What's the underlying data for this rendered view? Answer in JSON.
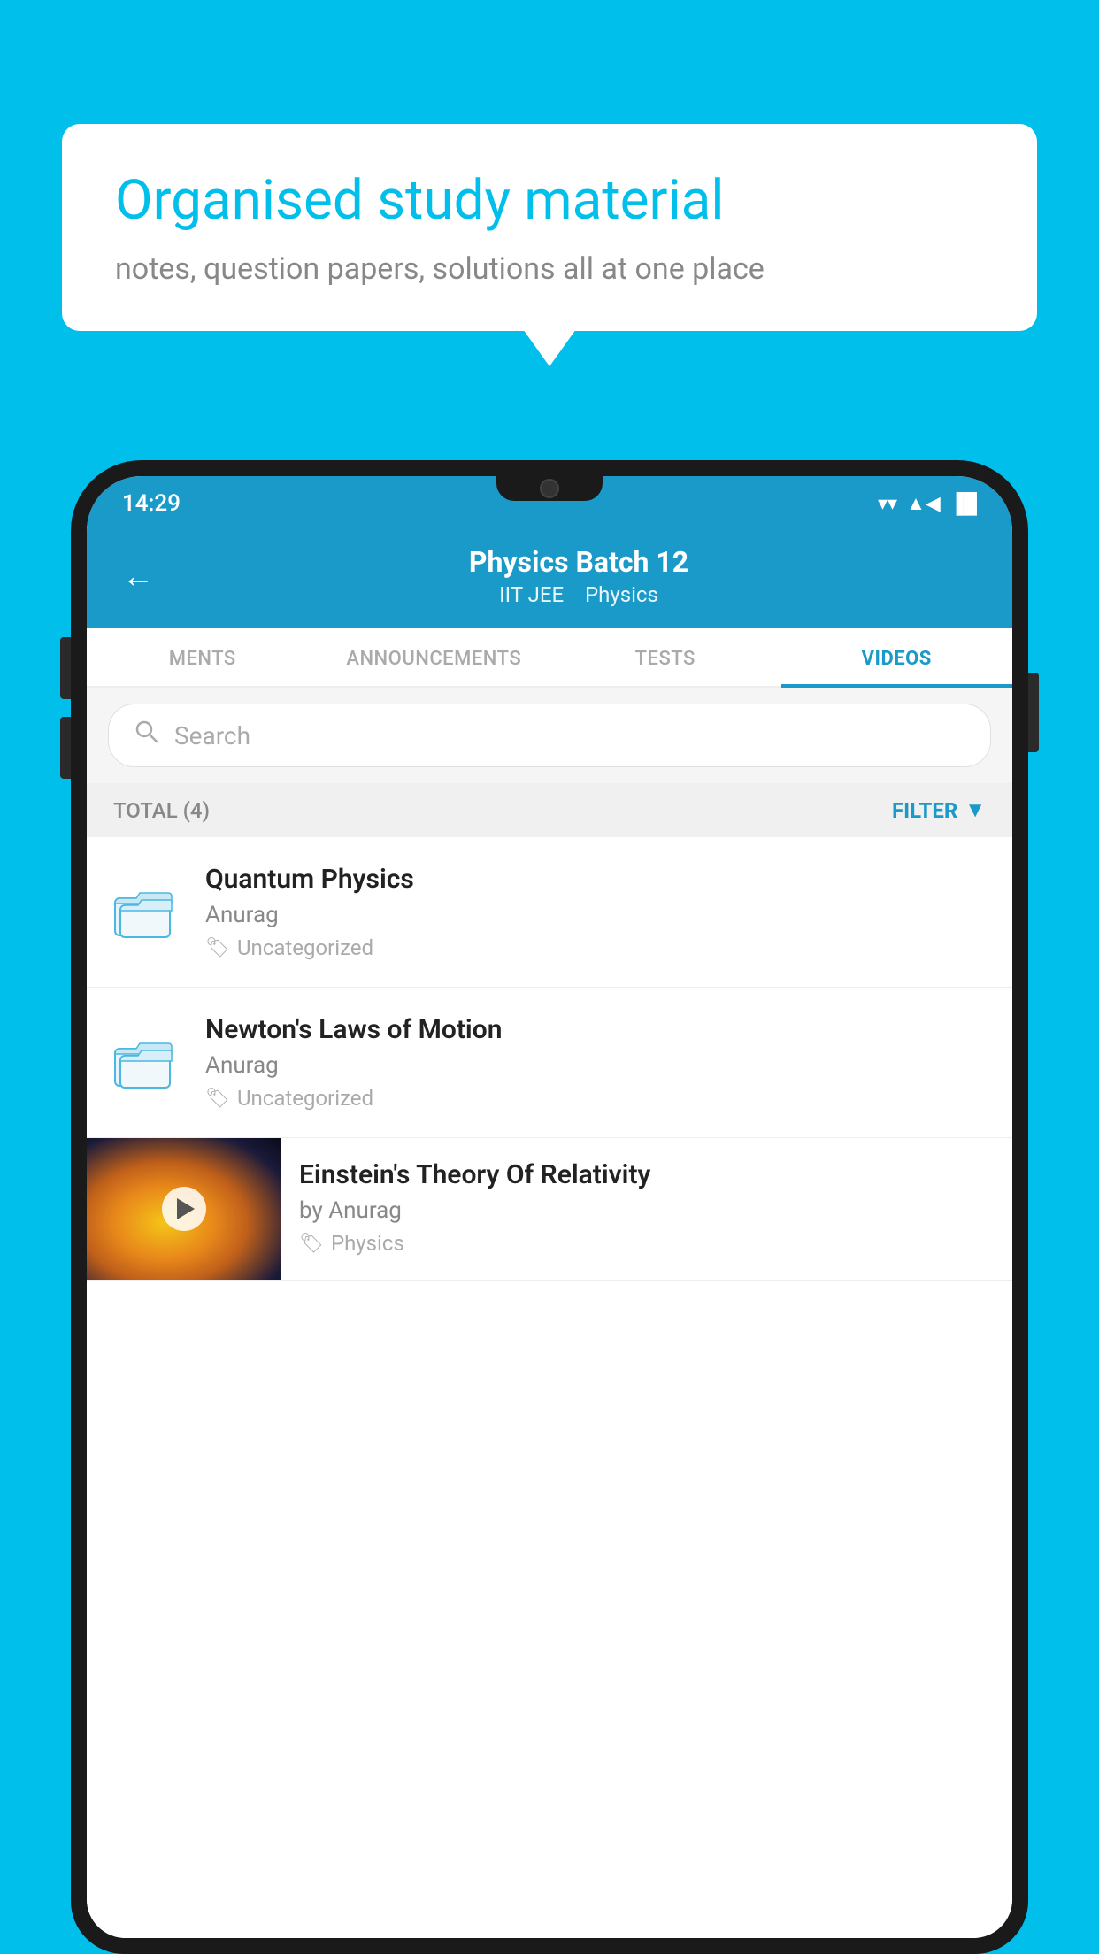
{
  "background_color": "#00BFEA",
  "speech_bubble": {
    "title": "Organised study material",
    "subtitle": "notes, question papers, solutions all at one place"
  },
  "phone": {
    "status_bar": {
      "time": "14:29"
    },
    "header": {
      "back_label": "←",
      "title": "Physics Batch 12",
      "subtitle_tag1": "IIT JEE",
      "subtitle_tag2": "Physics"
    },
    "tabs": [
      {
        "label": "MENTS",
        "active": false
      },
      {
        "label": "ANNOUNCEMENTS",
        "active": false
      },
      {
        "label": "TESTS",
        "active": false
      },
      {
        "label": "VIDEOS",
        "active": true
      }
    ],
    "search": {
      "placeholder": "Search"
    },
    "filter_bar": {
      "total_label": "TOTAL (4)",
      "filter_label": "FILTER"
    },
    "items": [
      {
        "type": "folder",
        "title": "Quantum Physics",
        "author": "Anurag",
        "tag": "Uncategorized"
      },
      {
        "type": "folder",
        "title": "Newton's Laws of Motion",
        "author": "Anurag",
        "tag": "Uncategorized"
      },
      {
        "type": "video",
        "title": "Einstein's Theory Of Relativity",
        "author": "by Anurag",
        "tag": "Physics"
      }
    ]
  }
}
